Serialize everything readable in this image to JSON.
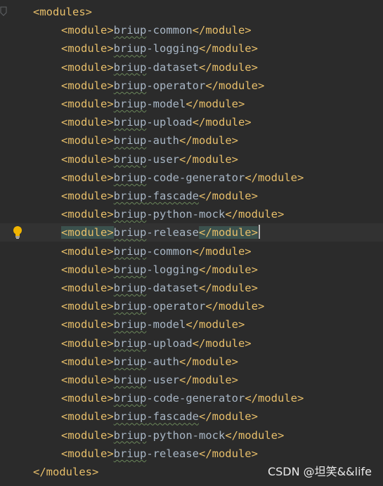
{
  "editor": {
    "lines": [
      {
        "open": "<modules>",
        "indent": 0
      },
      {
        "open": "<module>",
        "prefix": "briup",
        "suffix": "-common",
        "close": "</module>",
        "indent": 1
      },
      {
        "open": "<module>",
        "prefix": "briup",
        "suffix": "-logging",
        "close": "</module>",
        "indent": 1
      },
      {
        "open": "<module>",
        "prefix": "briup",
        "suffix": "-dataset",
        "close": "</module>",
        "indent": 1
      },
      {
        "open": "<module>",
        "prefix": "briup",
        "suffix": "-operator",
        "close": "</module>",
        "indent": 1
      },
      {
        "open": "<module>",
        "prefix": "briup",
        "suffix": "-model",
        "close": "</module>",
        "indent": 1
      },
      {
        "open": "<module>",
        "prefix": "briup",
        "suffix": "-upload",
        "close": "</module>",
        "indent": 1
      },
      {
        "open": "<module>",
        "prefix": "briup",
        "suffix": "-auth",
        "close": "</module>",
        "indent": 1
      },
      {
        "open": "<module>",
        "prefix": "briup",
        "suffix": "-user",
        "close": "</module>",
        "indent": 1
      },
      {
        "open": "<module>",
        "prefix": "briup",
        "suffix": "-code-generator",
        "close": "</module>",
        "indent": 1
      },
      {
        "open": "<module>",
        "prefix": "briup",
        "suffix": "-fascade",
        "close": "</module>",
        "indent": 1,
        "underline_suffix": true
      },
      {
        "open": "<module>",
        "prefix": "briup",
        "suffix": "-python-mock",
        "close": "</module>",
        "indent": 1
      },
      {
        "open": "<module>",
        "prefix": "briup",
        "suffix": "-release",
        "close": "</module>",
        "indent": 1,
        "current": true
      },
      {
        "open": "<module>",
        "prefix": "briup",
        "suffix": "-common",
        "close": "</module>",
        "indent": 1
      },
      {
        "open": "<module>",
        "prefix": "briup",
        "suffix": "-logging",
        "close": "</module>",
        "indent": 1
      },
      {
        "open": "<module>",
        "prefix": "briup",
        "suffix": "-dataset",
        "close": "</module>",
        "indent": 1
      },
      {
        "open": "<module>",
        "prefix": "briup",
        "suffix": "-operator",
        "close": "</module>",
        "indent": 1
      },
      {
        "open": "<module>",
        "prefix": "briup",
        "suffix": "-model",
        "close": "</module>",
        "indent": 1
      },
      {
        "open": "<module>",
        "prefix": "briup",
        "suffix": "-upload",
        "close": "</module>",
        "indent": 1
      },
      {
        "open": "<module>",
        "prefix": "briup",
        "suffix": "-auth",
        "close": "</module>",
        "indent": 1
      },
      {
        "open": "<module>",
        "prefix": "briup",
        "suffix": "-user",
        "close": "</module>",
        "indent": 1
      },
      {
        "open": "<module>",
        "prefix": "briup",
        "suffix": "-code-generator",
        "close": "</module>",
        "indent": 1
      },
      {
        "open": "<module>",
        "prefix": "briup",
        "suffix": "-fascade",
        "close": "</module>",
        "indent": 1,
        "underline_suffix": true
      },
      {
        "open": "<module>",
        "prefix": "briup",
        "suffix": "-python-mock",
        "close": "</module>",
        "indent": 1
      },
      {
        "open": "<module>",
        "prefix": "briup",
        "suffix": "-release",
        "close": "</module>",
        "indent": 1
      },
      {
        "open": "</modules>",
        "indent": 0
      }
    ]
  },
  "icons": {
    "intention": "lightbulb-icon",
    "fold": "fold-marker-icon"
  },
  "colors": {
    "background": "#2b2b2b",
    "tag": "#e8bf6a",
    "text": "#a9b7c6",
    "current_line": "#323232",
    "tag_match_highlight": "#3b514d",
    "bulb": "#f0b400"
  },
  "watermark": {
    "text": "CSDN @坦笑&&life"
  }
}
